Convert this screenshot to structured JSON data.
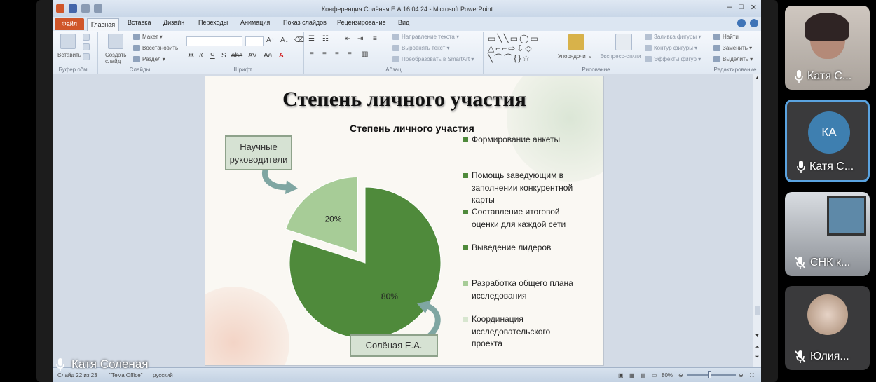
{
  "window": {
    "title": "Конференция Солёная Е.А 16.04.24 - Microsoft PowerPoint"
  },
  "tabs": [
    "Файл",
    "Главная",
    "Вставка",
    "Дизайн",
    "Переходы",
    "Анимация",
    "Показ слайдов",
    "Рецензирование",
    "Вид"
  ],
  "ribbon": {
    "clipboard": {
      "paste": "Вставить",
      "group": "Буфер обм..."
    },
    "slides": {
      "new_slide": "Создать слайд",
      "layout": "Макет",
      "reset": "Восстановить",
      "section": "Раздел",
      "group": "Слайды"
    },
    "font": {
      "group": "Шрифт",
      "bold": "Ж",
      "italic": "К",
      "underline": "Ч",
      "shadow": "S",
      "strike": "abc",
      "spacing": "AV",
      "case": "Aa",
      "color": "A"
    },
    "paragraph": {
      "text_direction": "Направление текста",
      "align_text": "Выровнять текст",
      "smartart": "Преобразовать в SmartArt",
      "group": "Абзац"
    },
    "drawing": {
      "arrange": "Упорядочить",
      "quick_styles": "Экспресс-стили",
      "fill": "Заливка фигуры",
      "outline": "Контур фигуры",
      "effects": "Эффекты фигур",
      "group": "Рисование"
    },
    "editing": {
      "find": "Найти",
      "replace": "Заменить",
      "select": "Выделить",
      "group": "Редактирование"
    }
  },
  "slide": {
    "title": "Степень личного участия",
    "callout_top": "Научные руководители",
    "callout_bottom": "Солёная Е.А."
  },
  "chart_data": {
    "type": "pie",
    "title": "Степень личного участия",
    "slices": [
      {
        "label": "20%",
        "value": 20,
        "color": "#a7cc97",
        "exploded": true
      },
      {
        "label": "80%",
        "value": 80,
        "color": "#4f8a3b",
        "exploded": false
      }
    ],
    "legend": [
      {
        "text": "Формирование анкеты",
        "color": "#4f8a3b"
      },
      {
        "text": "Помощь заведующим в заполнении конкурентной карты",
        "color": "#4f8a3b"
      },
      {
        "text": "Составление итоговой оценки для каждой сети",
        "color": "#4f8a3b"
      },
      {
        "text": "Выведение лидеров",
        "color": "#4f8a3b"
      },
      {
        "text": "Разработка общего плана исследования",
        "color": "#a7cc97"
      },
      {
        "text": "Координация исследовательского проекта",
        "color": "#d7e6cf"
      }
    ],
    "legend_position": "right"
  },
  "status": {
    "slide": "Слайд 22 из 23",
    "theme": "\"Тема Office\"",
    "language": "русский",
    "zoom": "80%"
  },
  "presenter": {
    "name": "Катя Соленая"
  },
  "participants": [
    {
      "name": "Катя С...",
      "initials": "",
      "muted": false,
      "kind": "video"
    },
    {
      "name": "Катя С...",
      "initials": "КА",
      "muted": false,
      "kind": "avatar",
      "active": true
    },
    {
      "name": "СНК к...",
      "initials": "",
      "muted": true,
      "kind": "video"
    },
    {
      "name": "Юлия...",
      "initials": "",
      "muted": true,
      "kind": "photo"
    }
  ]
}
